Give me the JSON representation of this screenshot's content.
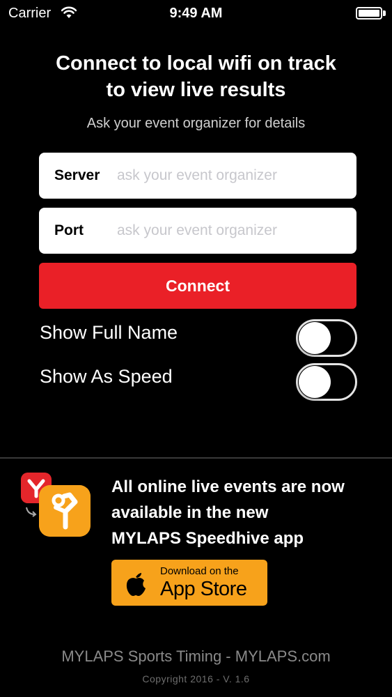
{
  "status_bar": {
    "carrier": "Carrier",
    "time": "9:49 AM",
    "icons": [
      "wifi-icon",
      "battery-icon"
    ]
  },
  "header": {
    "title_line1": "Connect to local wifi on track",
    "title_line2": "to view live results",
    "subtitle": "Ask your event organizer for details"
  },
  "form": {
    "server": {
      "label": "Server",
      "value": "",
      "placeholder": "ask your event organizer"
    },
    "port": {
      "label": "Port",
      "value": "",
      "placeholder": "ask your event organizer"
    },
    "connect_label": "Connect"
  },
  "settings": {
    "show_full_name": {
      "label": "Show Full Name",
      "on": false
    },
    "show_as_speed": {
      "label": "Show As Speed",
      "on": false
    }
  },
  "promo": {
    "line1": "All online live events are now",
    "line2": "available in the new",
    "line3": "MYLAPS Speedhive app",
    "store_line1": "Download on the",
    "store_line2": "App Store",
    "icons": [
      "mylaps-app-icon",
      "speedhive-app-icon",
      "apple-icon"
    ]
  },
  "footer": {
    "main": "MYLAPS Sports Timing - MYLAPS.com",
    "copyright": "Copyright 2016 - V. 1.6"
  },
  "colors": {
    "background": "#000000",
    "connect_button": "#ea2027",
    "speedhive_orange": "#f7a21b",
    "mylaps_red": "#e4262b"
  }
}
